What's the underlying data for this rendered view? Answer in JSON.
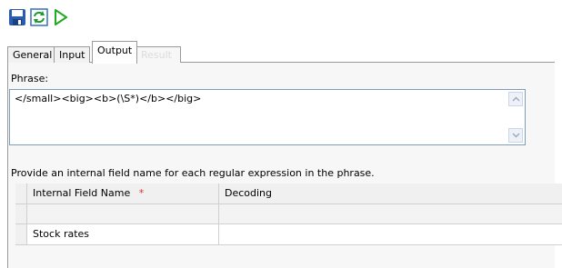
{
  "toolbar": {
    "save_icon": "save-icon",
    "refresh_icon": "refresh-icon",
    "run_icon": "run-icon"
  },
  "tabs": [
    {
      "label": "General"
    },
    {
      "label": "Input"
    },
    {
      "label": "Output"
    },
    {
      "label": "Result"
    }
  ],
  "phrase": {
    "label": "Phrase:",
    "value": "</small><big><b>(\\S*)</b></big>"
  },
  "instruction": "Provide an internal field name for each regular expression in the phrase.",
  "grid": {
    "columns": [
      "Internal Field Name",
      "Decoding"
    ],
    "required_marker": "*",
    "rows": [
      {
        "field": "",
        "decoding": ""
      },
      {
        "field": "Stock rates",
        "decoding": ""
      }
    ]
  },
  "colors": {
    "required": "#e03030",
    "run_icon": "#22aa22",
    "save_icon": "#2a5db0"
  }
}
